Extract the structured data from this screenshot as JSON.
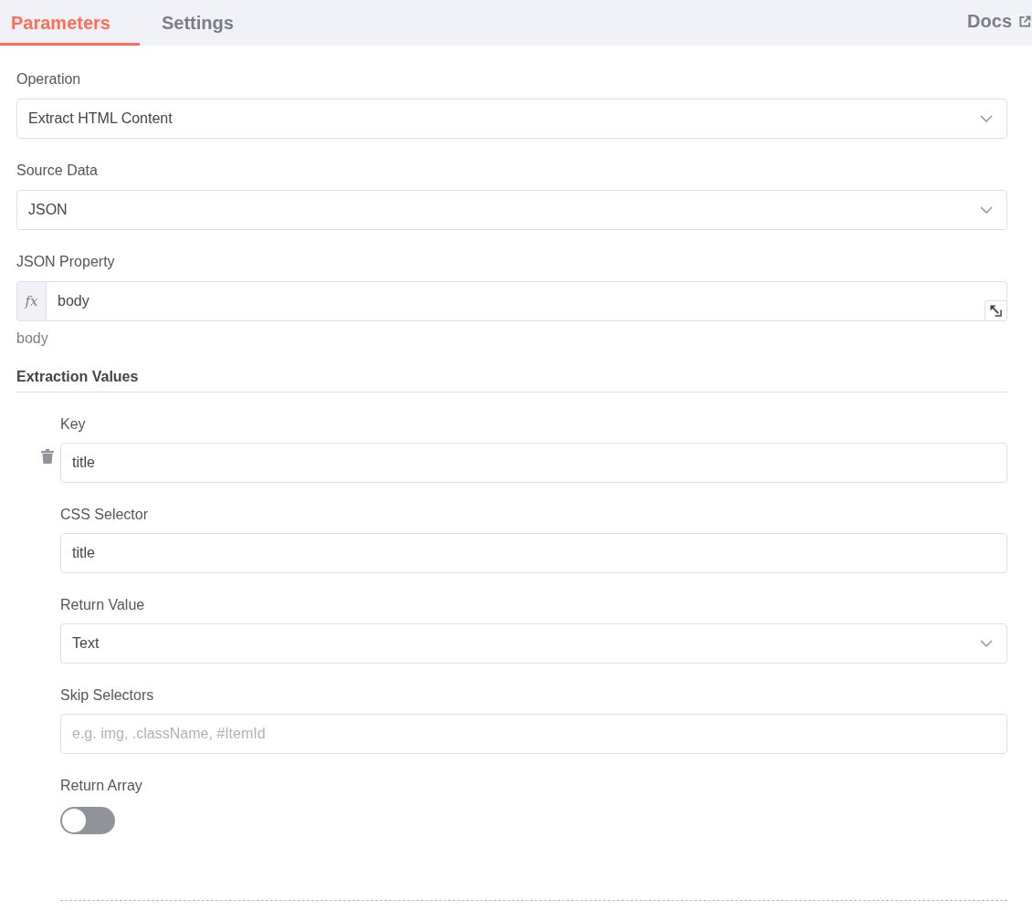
{
  "tabs": [
    {
      "label": "Parameters",
      "selected": true
    },
    {
      "label": "Settings",
      "selected": false
    }
  ],
  "docs_link": {
    "label": "Docs"
  },
  "parameters": [
    {
      "kind": "dropdown",
      "label": "Operation",
      "value": "Extract HTML Content"
    },
    {
      "kind": "dropdown",
      "label": "Source Data",
      "value": "JSON"
    },
    {
      "kind": "expression",
      "label": "JSON Property",
      "prefix": "fx",
      "value": "body",
      "hint": "body"
    }
  ],
  "extraction_values": {
    "title": "Extraction Values",
    "items": [
      {
        "fields": [
          {
            "kind": "text",
            "label": "Key",
            "value": "title"
          },
          {
            "kind": "text",
            "label": "CSS Selector",
            "value": "title"
          },
          {
            "kind": "dropdown",
            "label": "Return Value",
            "value": "Text"
          },
          {
            "kind": "text",
            "label": "Skip Selectors",
            "placeholder": "e.g. img, .className, #ItemId"
          },
          {
            "kind": "toggle",
            "label": "Return Array",
            "on": false
          }
        ]
      }
    ]
  }
}
